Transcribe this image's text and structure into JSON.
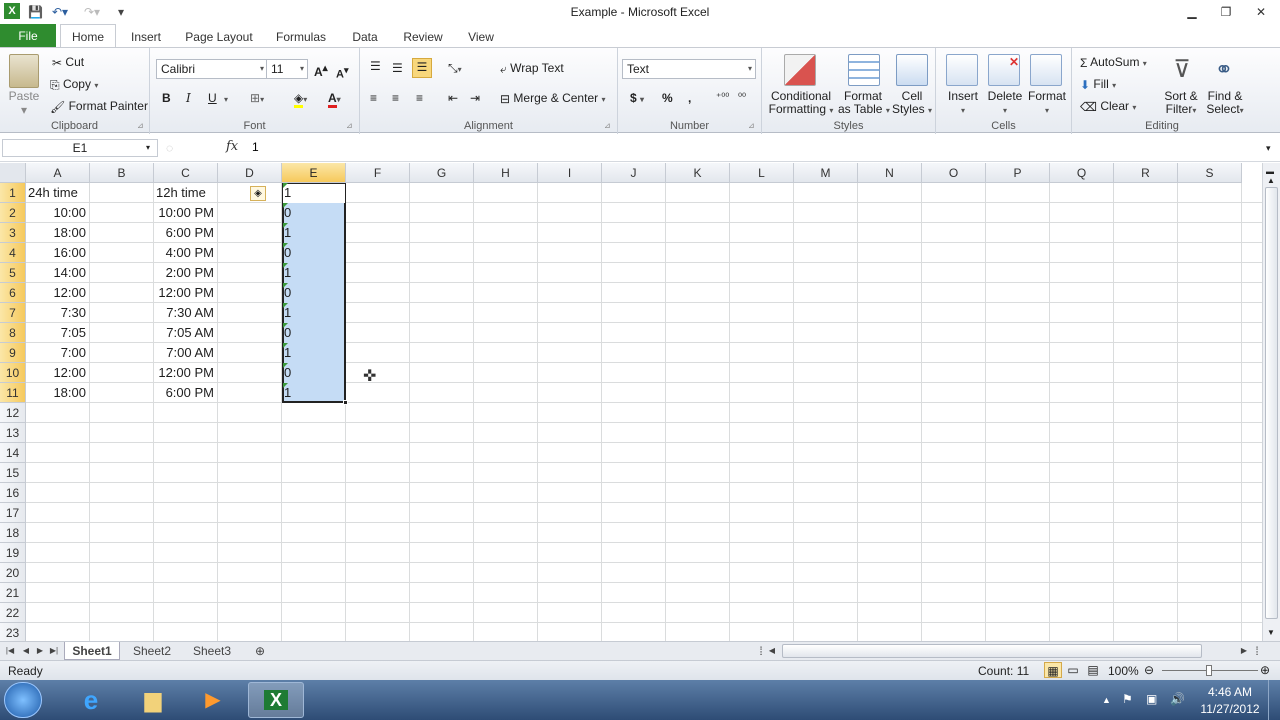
{
  "window": {
    "title": "Example  -  Microsoft Excel"
  },
  "tabs": [
    "File",
    "Home",
    "Insert",
    "Page Layout",
    "Formulas",
    "Data",
    "Review",
    "View"
  ],
  "active_tab": "Home",
  "ribbon": {
    "clipboard": {
      "label": "Clipboard",
      "paste": "Paste",
      "cut": "Cut",
      "copy": "Copy",
      "format_painter": "Format Painter"
    },
    "font": {
      "label": "Font",
      "font_name": "Calibri",
      "font_size": "11",
      "bold": "B",
      "italic": "I",
      "underline": "U"
    },
    "alignment": {
      "label": "Alignment",
      "wrap_text": "Wrap Text",
      "merge_center": "Merge & Center"
    },
    "number": {
      "label": "Number",
      "format": "Text",
      "currency": "$",
      "percent": "%",
      "comma": ","
    },
    "styles": {
      "label": "Styles",
      "conditional": "Conditional",
      "conditional2": "Formatting",
      "format_table": "Format",
      "format_table2": "as Table",
      "cell_styles": "Cell",
      "cell_styles2": "Styles"
    },
    "cells": {
      "label": "Cells",
      "insert": "Insert",
      "delete": "Delete",
      "format": "Format"
    },
    "editing": {
      "label": "Editing",
      "autosum": "AutoSum",
      "fill": "Fill",
      "clear": "Clear",
      "sort": "Sort &",
      "sort2": "Filter",
      "find": "Find &",
      "find2": "Select"
    }
  },
  "formula_bar": {
    "name_box": "E1",
    "fx": "fx",
    "value": "1"
  },
  "columns": [
    "A",
    "B",
    "C",
    "D",
    "E",
    "F",
    "G",
    "H",
    "I",
    "J",
    "K",
    "L",
    "M",
    "N",
    "O",
    "P",
    "Q",
    "R",
    "S"
  ],
  "rows": [
    "1",
    "2",
    "3",
    "4",
    "5",
    "6",
    "7",
    "8",
    "9",
    "10",
    "11",
    "12",
    "13",
    "14",
    "15",
    "16",
    "17",
    "18",
    "19",
    "20",
    "21",
    "22",
    "23"
  ],
  "cells": {
    "A": [
      "24h time",
      "10:00",
      "18:00",
      "16:00",
      "14:00",
      "12:00",
      "7:30",
      "7:05",
      "7:00",
      "12:00",
      "18:00"
    ],
    "C": [
      "12h time",
      "10:00 PM",
      "6:00 PM",
      "4:00 PM",
      "2:00 PM",
      "12:00 PM",
      "7:30 AM",
      "7:05 AM",
      "7:00 AM",
      "12:00 PM",
      "6:00 PM"
    ],
    "E": [
      "1",
      "0",
      "1",
      "0",
      "1",
      "0",
      "1",
      "0",
      "1",
      "0",
      "1"
    ]
  },
  "sheets": [
    "Sheet1",
    "Sheet2",
    "Sheet3"
  ],
  "active_sheet": "Sheet1",
  "status": {
    "mode": "Ready",
    "count": "Count: 11",
    "zoom": "100%"
  },
  "taskbar": {
    "time": "4:46 AM",
    "date": "11/27/2012"
  },
  "colors": {
    "file_tab": "#2f8c2f",
    "selection": "#c5dcf5",
    "header_selected": "#f6c95c"
  }
}
